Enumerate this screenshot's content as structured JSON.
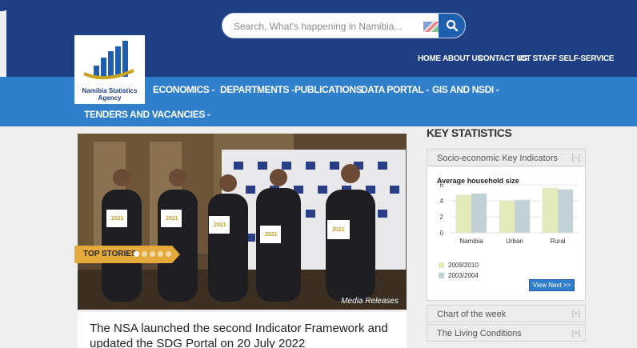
{
  "header": {
    "search_placeholder": "Search, What's happening in Namibia...",
    "top_nav": [
      "HOME",
      "ABOUT US",
      "CONTACT US",
      "ICT STAFF SELF-SERVICE"
    ],
    "logo_text": "Namibia Statistics Agency"
  },
  "menu": {
    "items": [
      "ECONOMICS -",
      "DEPARTMENTS -",
      "PUBLICATIONS",
      "DATA PORTAL -",
      "GIS AND NSDI -",
      "TENDERS AND VACANCIES -"
    ]
  },
  "hero": {
    "badge": "TOP STORIES",
    "caption": "Media Releases",
    "headline": "The NSA launched the second Indicator Framework and updated the SDG Portal on 20 July 2022",
    "booklet_label": "2021"
  },
  "sidebar": {
    "title": "KEY STATISTICS",
    "panels": [
      {
        "label": "Socio-economic Key Indicators",
        "toggle": "[−]"
      },
      {
        "label": "Chart of the week",
        "toggle": "[+]"
      },
      {
        "label": "The Living Conditions",
        "toggle": "[+]"
      }
    ],
    "view_next": "View Next >>"
  },
  "chart_data": {
    "type": "bar",
    "title": "Average household size",
    "categories": [
      "Namibia",
      "Urban",
      "Rural"
    ],
    "series": [
      {
        "name": "2009/2010",
        "values": [
          4.7,
          4.0,
          5.6
        ],
        "color": "#e3ebbb"
      },
      {
        "name": "2003/2004",
        "values": [
          4.9,
          4.1,
          5.4
        ],
        "color": "#c2d1d6"
      }
    ],
    "ylim": [
      0,
      6
    ],
    "yticks": [
      "0",
      "2",
      "4",
      "6"
    ],
    "grid": true,
    "legend": "bottom-left"
  }
}
